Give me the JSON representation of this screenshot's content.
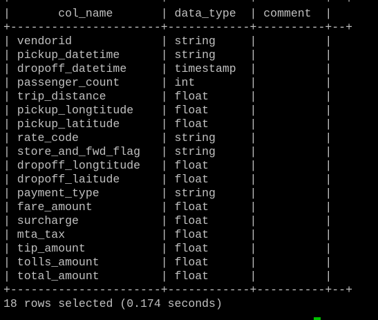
{
  "terminal": {
    "lines": [
      "+----------------------+------------+----------+--+",
      "|       col_name       | data_type  | comment  |",
      "+----------------------+------------+----------+--+",
      "| vendorid             | string     |          |",
      "| pickup_datetime      | string     |          |",
      "| dropoff_datetime     | timestamp  |          |",
      "| passenger_count      | int        |          |",
      "| trip_distance        | float      |          |",
      "| pickup_longtitude    | float      |          |",
      "| pickup_latitude      | float      |          |",
      "| rate_code            | string     |          |",
      "| store_and_fwd_flag   | string     |          |",
      "| dropoff_longtitude   | float      |          |",
      "| dropoff_laitude      | float      |          |",
      "| payment_type         | string     |          |",
      "| fare_amount          | float      |          |",
      "| surcharge            | float      |          |",
      "| mta_tax              | float      |          |",
      "| tip_amount           | float      |          |",
      "| tolls_amount         | float      |          |",
      "| total_amount         | float      |          |",
      "+----------------------+------------+----------+--+",
      "18 rows selected (0.174 seconds)"
    ],
    "text_color": "#c0c0c0",
    "background_color": "#000000",
    "cursor_color": "#00c000"
  }
}
